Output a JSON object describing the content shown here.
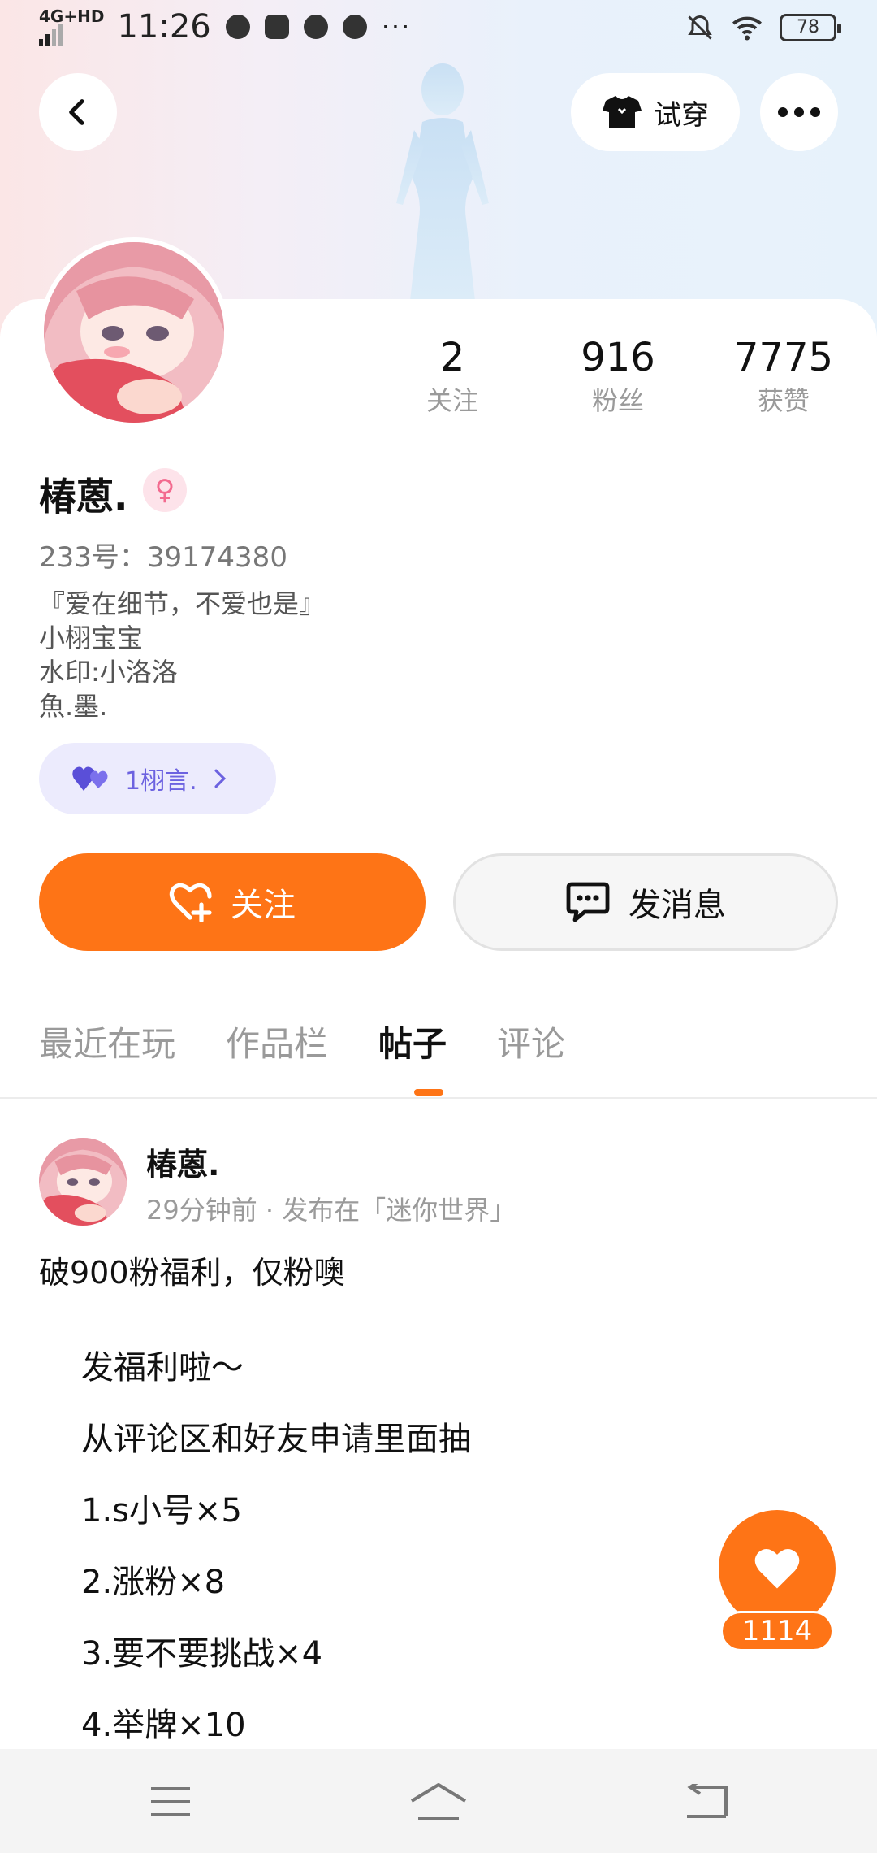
{
  "status_bar": {
    "network": "4G+HD",
    "time": "11:26",
    "battery": "78",
    "more": "···"
  },
  "header": {
    "tryon_label": "试穿"
  },
  "profile": {
    "stats": [
      {
        "value": "2",
        "label": "关注"
      },
      {
        "value": "916",
        "label": "粉丝"
      },
      {
        "value": "7775",
        "label": "获赞"
      }
    ],
    "name": "椿蒽.",
    "gender_symbol": "♀",
    "uid": "233号：39174380",
    "bio": [
      "『爱在细节，不爱也是』",
      "小栩宝宝",
      "水印:小洛洛",
      "魚.墨."
    ],
    "group_tag": "1栩言.",
    "follow_label": "关注",
    "message_label": "发消息"
  },
  "tabs": [
    {
      "label": "最近在玩",
      "active": false
    },
    {
      "label": "作品栏",
      "active": false
    },
    {
      "label": "帖子",
      "active": true
    },
    {
      "label": "评论",
      "active": false
    }
  ],
  "post": {
    "author": "椿蒽.",
    "meta": "29分钟前 · 发布在「迷你世界」",
    "title": "破900粉福利，仅粉噢",
    "lines": [
      "发福利啦～",
      "从评论区和好友申请里面抽",
      "1.s小号×5",
      "2.涨粉×8",
      "3.要不要挑战×4",
      "4.举牌×10"
    ]
  },
  "like": {
    "count": "1114"
  },
  "colors": {
    "accent": "#fe7416",
    "tag_bg": "#ecebfd",
    "tag_text": "#6c62e0"
  }
}
